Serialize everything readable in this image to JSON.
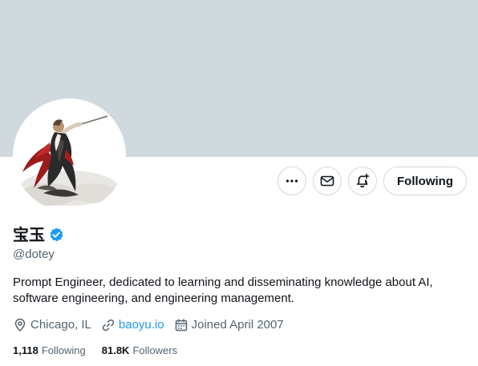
{
  "profile": {
    "display_name": "宝玉",
    "handle": "@dotey",
    "verified": true,
    "bio": "Prompt Engineer, dedicated to learning and disseminating knowledge about AI, software engineering, and engineering management.",
    "location": "Chicago, IL",
    "website": "baoyu.io",
    "joined": "Joined April 2007",
    "following_count": "1,118",
    "following_label": "Following",
    "followers_count": "81.8K",
    "followers_label": "Followers"
  },
  "actions": {
    "follow_state_label": "Following",
    "more_icon": "more-horizontal-icon",
    "message_icon": "envelope-icon",
    "notify_icon": "bell-plus-icon"
  },
  "colors": {
    "banner": "#cfd9de",
    "accent": "#1d9bf0",
    "secondary_text": "#536471",
    "primary_text": "#0f1419"
  }
}
